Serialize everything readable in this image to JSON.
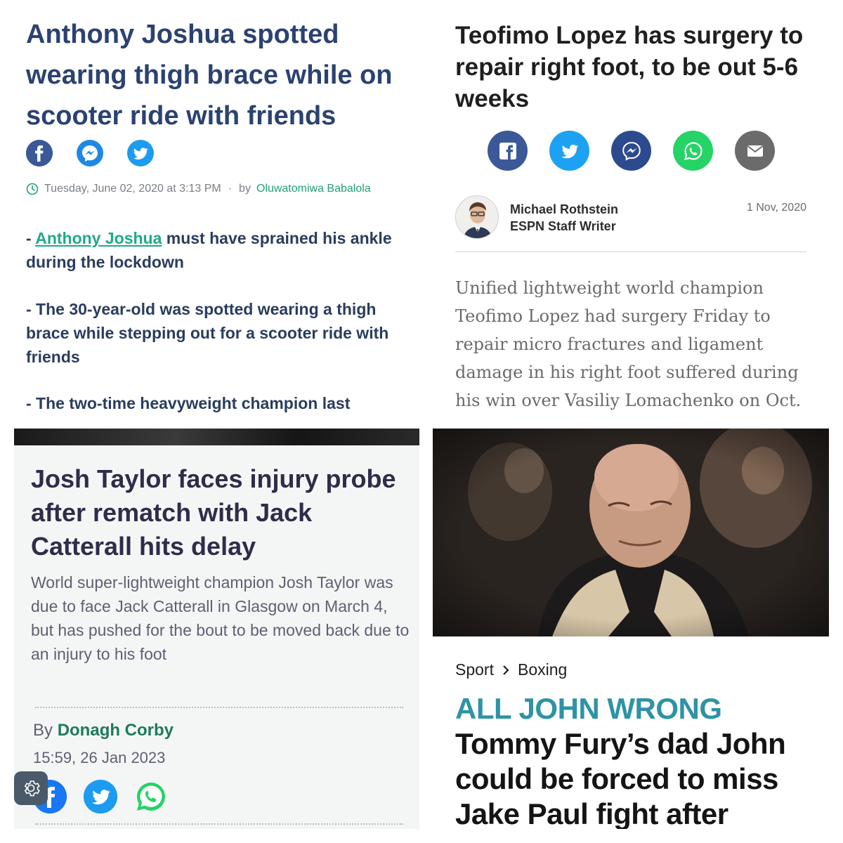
{
  "panel1": {
    "headline": "Anthony Joshua spotted wearing thigh brace while on scooter ride with friends",
    "date": "Tuesday, June 02, 2020 at 3:13 PM",
    "by": "by",
    "author": "Oluwatomiwa Babalola",
    "bullet1_prefix": "- ",
    "bullet1_link": "Anthony Joshua",
    "bullet1_rest": " must have sprained his ankle during the lockdown",
    "bullet2": "- The 30-year-old was spotted wearing a thigh brace while stepping out for a scooter ride with friends",
    "bullet3": "- The two-time heavyweight champion last",
    "colors": {
      "headline": "#2b4271",
      "link": "#1faa88",
      "facebook": "#3b5998",
      "messenger": "#1e88e5",
      "twitter": "#1d9bf0"
    },
    "share_icons": [
      "facebook-icon",
      "messenger-icon",
      "twitter-icon"
    ]
  },
  "panel2": {
    "headline": "Teofimo Lopez has surgery to repair right foot, to be out 5-6 weeks",
    "author_name": "Michael Rothstein",
    "author_title": "ESPN Staff Writer",
    "date": "1 Nov, 2020",
    "body": "Unified lightweight world champion Teofimo Lopez had surgery Friday to repair micro fractures and ligament damage in his right foot suffered during his win over Vasiliy Lomachenko on Oct.",
    "share_icons": [
      "facebook-icon",
      "twitter-icon",
      "messenger-icon",
      "whatsapp-icon",
      "email-icon"
    ],
    "colors": {
      "facebook": "#3b5998",
      "twitter": "#1da1f2",
      "messenger": "#2c4a8e",
      "whatsapp": "#25d366",
      "email": "#6b6b6b"
    }
  },
  "panel3": {
    "headline": "Josh Taylor faces injury probe after rematch with Jack Catterall hits delay",
    "standfirst": "World super-lightweight champion Josh Taylor was due to face Jack Catterall in Glasgow on March 4, but has pushed for the bout to be moved back due to an injury to his foot",
    "by": "By",
    "author": "Donagh Corby",
    "timestamp": "15:59, 26 Jan 2023",
    "share_icons": [
      "facebook-icon",
      "twitter-icon",
      "whatsapp-icon"
    ],
    "colors": {
      "headline": "#2e2d4a",
      "author": "#1f7a5c"
    }
  },
  "panel4": {
    "breadcrumb_section": "Sport",
    "breadcrumb_sub": "Boxing",
    "headline_kicker": "ALL JOHN WRONG",
    "headline_rest": " Tommy Fury’s dad John could be forced to miss Jake Paul fight after breaking ankle",
    "colors": {
      "kicker": "#2e93a6"
    }
  }
}
